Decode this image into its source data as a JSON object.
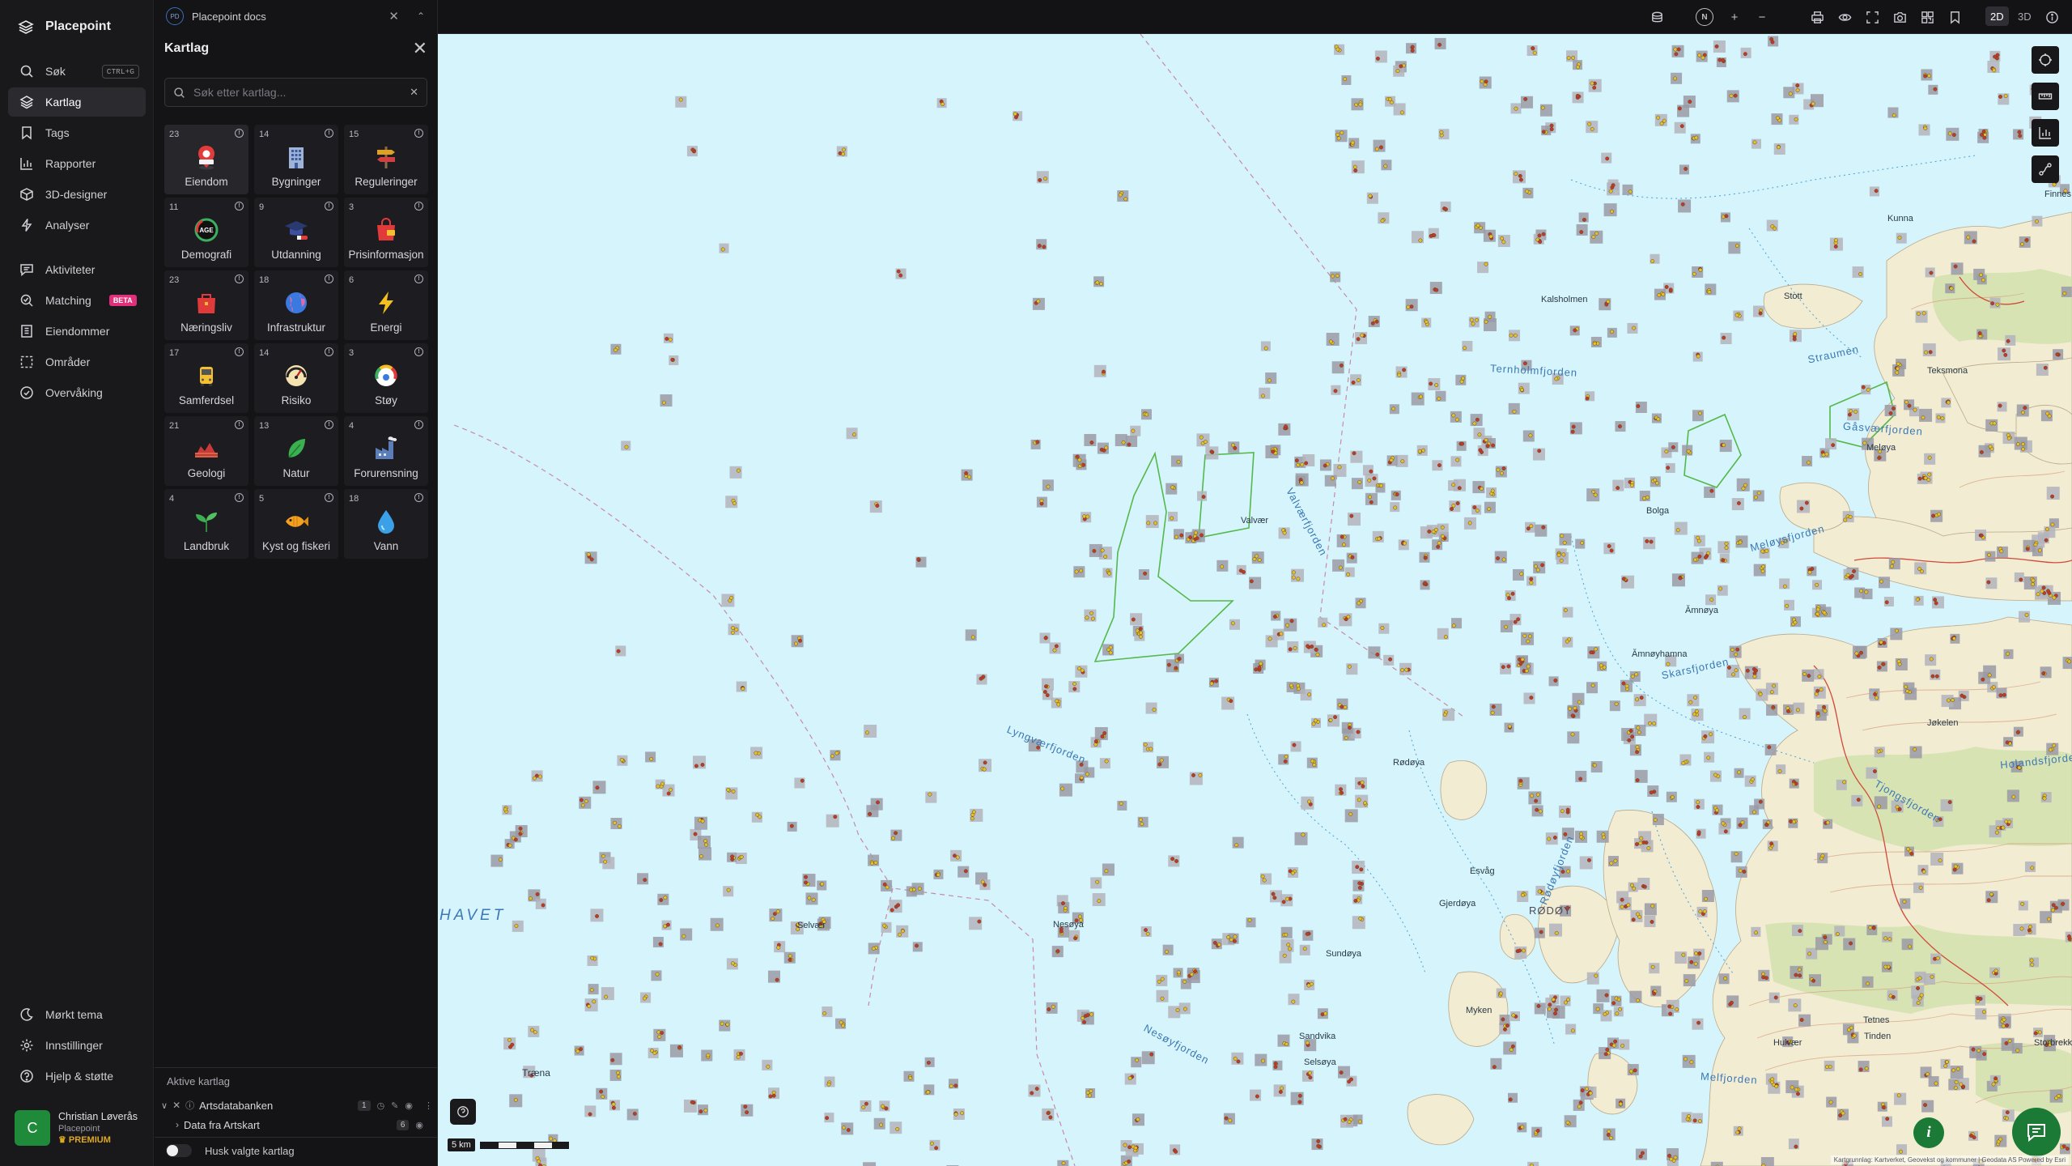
{
  "app": {
    "brand": "Placepoint"
  },
  "nav": {
    "items": [
      {
        "label": "Søk",
        "shortcut": "CTRL+G",
        "icon": "search-icon"
      },
      {
        "label": "Kartlag",
        "icon": "layers-icon"
      },
      {
        "label": "Tags",
        "icon": "bookmark-icon"
      },
      {
        "label": "Rapporter",
        "icon": "bar-chart-icon"
      },
      {
        "label": "3D-designer",
        "icon": "cube-icon"
      },
      {
        "label": "Analyser",
        "icon": "bolt-icon"
      },
      {
        "label": "Aktiviteter",
        "icon": "chat-icon"
      },
      {
        "label": "Matching",
        "badge": "BETA",
        "icon": "match-search-icon"
      },
      {
        "label": "Eiendommer",
        "icon": "building-icon"
      },
      {
        "label": "Områder",
        "icon": "dashed-square-icon"
      },
      {
        "label": "Overvåking",
        "icon": "check-circle-icon"
      }
    ],
    "bottom": [
      {
        "label": "Mørkt tema",
        "icon": "moon-icon"
      },
      {
        "label": "Innstillinger",
        "icon": "gear-icon"
      },
      {
        "label": "Hjelp & støtte",
        "icon": "help-icon"
      }
    ],
    "user": {
      "initial": "C",
      "name": "Christian Løverås",
      "org": "Placepoint",
      "plan": "PREMIUM"
    }
  },
  "doc_tab": {
    "badge": "PD",
    "title": "Placepoint docs"
  },
  "panel": {
    "title": "Kartlag",
    "search_placeholder": "Søk etter kartlag...",
    "categories": [
      {
        "count": "23",
        "label": "Eiendom",
        "icon": "pin-icon"
      },
      {
        "count": "14",
        "label": "Bygninger",
        "icon": "office-building-icon"
      },
      {
        "count": "15",
        "label": "Reguleringer",
        "icon": "signpost-icon"
      },
      {
        "count": "11",
        "label": "Demografi",
        "icon": "age-gauge-icon"
      },
      {
        "count": "9",
        "label": "Utdanning",
        "icon": "graduation-cap-icon"
      },
      {
        "count": "3",
        "label": "Prisinformasjon",
        "icon": "shopping-bag-icon"
      },
      {
        "count": "23",
        "label": "Næringsliv",
        "icon": "briefcase-icon"
      },
      {
        "count": "18",
        "label": "Infrastruktur",
        "icon": "globe-icon"
      },
      {
        "count": "6",
        "label": "Energi",
        "icon": "lightning-icon"
      },
      {
        "count": "17",
        "label": "Samferdsel",
        "icon": "bus-icon"
      },
      {
        "count": "14",
        "label": "Risiko",
        "icon": "risk-gauge-icon"
      },
      {
        "count": "3",
        "label": "Støy",
        "icon": "noise-gauge-icon"
      },
      {
        "count": "21",
        "label": "Geologi",
        "icon": "terrain-icon"
      },
      {
        "count": "13",
        "label": "Natur",
        "icon": "leaf-icon"
      },
      {
        "count": "4",
        "label": "Forurensning",
        "icon": "factory-icon"
      },
      {
        "count": "4",
        "label": "Landbruk",
        "icon": "sprout-icon"
      },
      {
        "count": "5",
        "label": "Kyst og fiskeri",
        "icon": "fish-icon"
      },
      {
        "count": "18",
        "label": "Vann",
        "icon": "water-drop-icon"
      }
    ],
    "active_title": "Aktive kartlag",
    "active_layers": [
      {
        "name": "Artsdatabanken",
        "count": "1"
      },
      {
        "name": "Data fra Artskart",
        "count": "6"
      }
    ],
    "remember_label": "Husk valgte kartlag"
  },
  "topbar": {
    "north": "N",
    "mode_2d": "2D",
    "mode_3d": "3D",
    "active_mode": "2D"
  },
  "map": {
    "sea_label": "HAVET",
    "water_labels": [
      "Ternholmfjorden",
      "Valværfjorden",
      "Lyngværfjorden",
      "Nesøyfjorden",
      "Skarsfjorden",
      "Melfjorden",
      "Holandsfjorden",
      "Tjongsfjorden",
      "Rødøyfjorden",
      "Meløysfjorden",
      "Gåsværfjorden",
      "Straumen",
      "Træna"
    ],
    "place_labels": [
      "Kalsholmen",
      "Valvær",
      "Bolga",
      "Ămnøya",
      "Ămnøyhamna",
      "Rødøya",
      "Esvåg",
      "Gjerdøya",
      "Nesøya",
      "Selsøya",
      "Sandvika",
      "Sundøya",
      "Teksmona",
      "Meløya",
      "Kunna",
      "Selvær",
      "Finnes",
      "Stott",
      "Jøkelen",
      "Tetnes",
      "Tinden",
      "Storbrekken",
      "Hulvær",
      "Myken"
    ],
    "island_label": "RØDØY",
    "scale": "5 km",
    "attribution": "Kartgrunnlag: Kartverket, Geovekst og kommuner | Geodata AS Powered by Esri"
  }
}
